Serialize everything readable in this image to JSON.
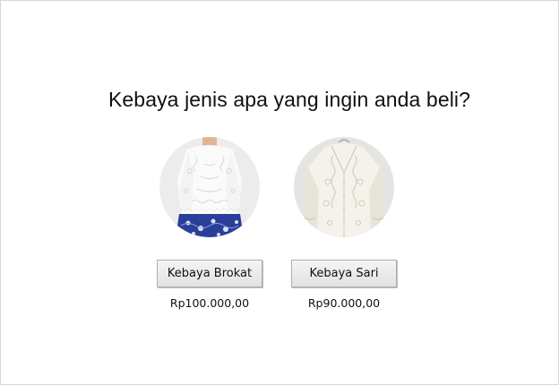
{
  "question": "Kebaya jenis apa yang ingin anda beli?",
  "products": [
    {
      "name": "Kebaya Brokat",
      "price": "Rp100.000,00",
      "image_icon": "kebaya-brokat-photo"
    },
    {
      "name": "Kebaya Sari",
      "price": "Rp90.000,00",
      "image_icon": "kebaya-sari-photo"
    }
  ],
  "colors": {
    "photo_background": "#ececec",
    "lace_white": "#fbfbfb",
    "batik_blue": "#2a3f9a",
    "button_border": "#adadad"
  }
}
